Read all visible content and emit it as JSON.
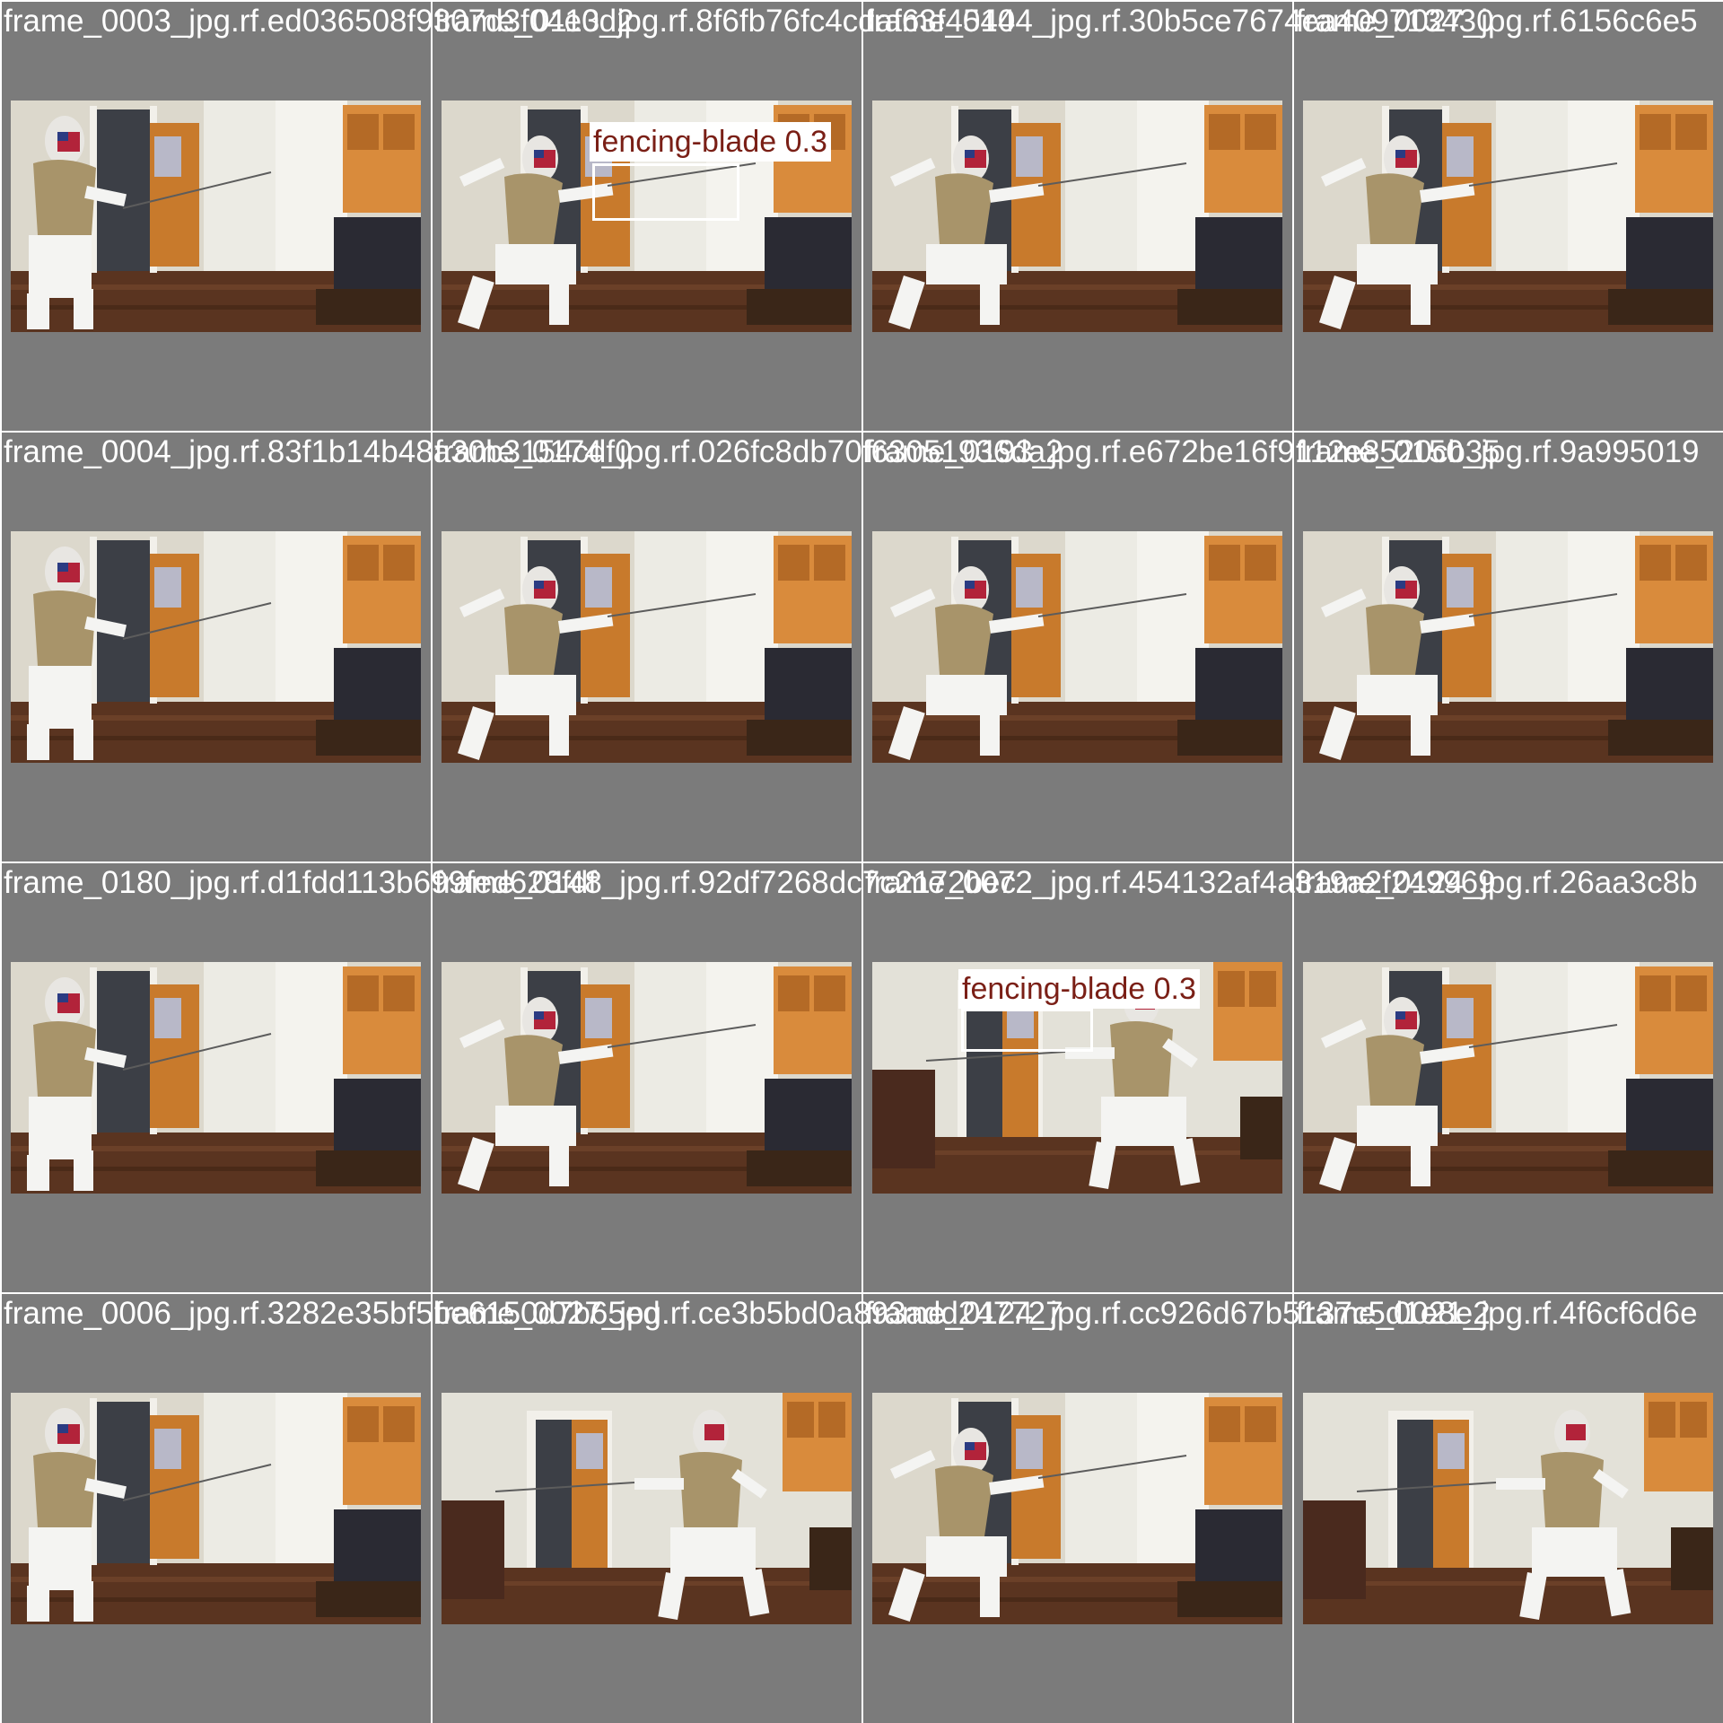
{
  "tiles": [
    {
      "name": "frame_0003_jpg.rf.ed036508f9307d3f04e0d2",
      "variant": "A"
    },
    {
      "name": "frame_0113_jpg.rf.8f6fb76fc4cdaf63f4540",
      "variant": "B",
      "detection": {
        "label": "fencing-blade 0.3"
      }
    },
    {
      "name": "frame_0144_jpg.rf.30b5ce7674ea409713430",
      "variant": "B"
    },
    {
      "name": "frame_0027_jpg.rf.6156c6e5",
      "variant": "B"
    },
    {
      "name": "frame_0004_jpg.rf.83f1b14b48a30b3154cdf0",
      "variant": "A"
    },
    {
      "name": "frame_0174_jpg.rf.026fc8db70f63051936da2",
      "variant": "B"
    },
    {
      "name": "frame_0193_jpg.rf.e672be16f9112e8520cb35",
      "variant": "B"
    },
    {
      "name": "frame_0150_jpg.rf.9a995019",
      "variant": "B"
    },
    {
      "name": "frame_0180_jpg.rf.d1fdd113b699fed628fdf",
      "variant": "A"
    },
    {
      "name": "frame_0148_jpg.rf.92df7268dc7c2172bec",
      "variant": "B"
    },
    {
      "name": "frame_0072_jpg.rf.454132af4a319a2f249969",
      "variant": "C",
      "detection": {
        "label": "fencing-blade 0.3"
      }
    },
    {
      "name": "frame_0124_jpg.rf.26aa3c8b",
      "variant": "B"
    },
    {
      "name": "frame_0006_jpg.rf.3282e35bf5be6150d7b65ed",
      "variant": "A"
    },
    {
      "name": "frame_0027_jpg.rf.ce3b5bd0a893add247727",
      "variant": "C"
    },
    {
      "name": "frame_0124_jpg.rf.cc926d67b5137c5d1e8e2",
      "variant": "B"
    },
    {
      "name": "frame_0021_jpg.rf.4f6cf6d6e",
      "variant": "C"
    }
  ],
  "colors": {
    "tile_background": "#7b7b7b",
    "title_text": "#ffffff",
    "box_border": "#ffffff",
    "label_background": "#ffffff",
    "label_text": "#7a1f16"
  }
}
